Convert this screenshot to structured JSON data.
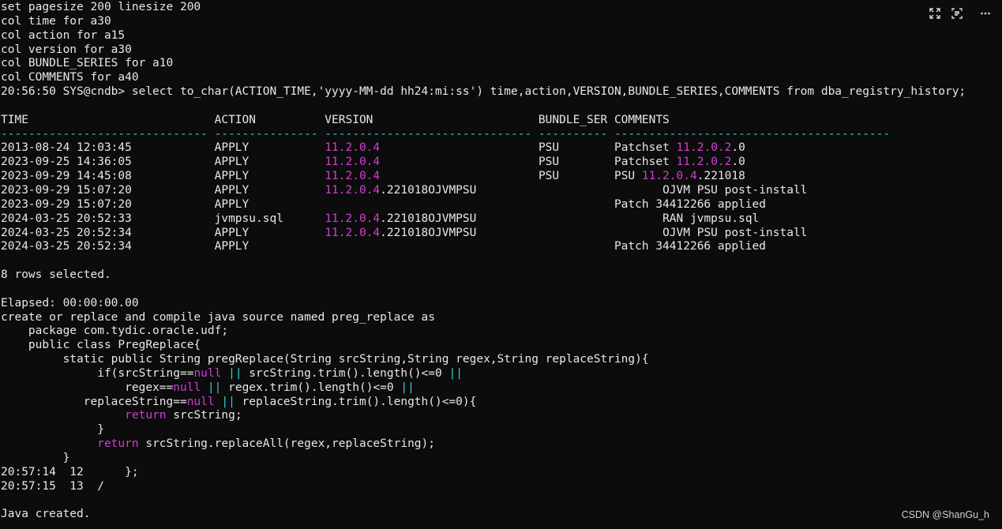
{
  "toolbar": {
    "icons": [
      "expand-icon",
      "ocr-scan-icon",
      "more-options-icon"
    ]
  },
  "colors": {
    "background": "#0c0c0c",
    "text": "#e8e8e8",
    "highlight_magenta": "#d33ed3",
    "separator_cyan": "#3ec8d8"
  },
  "terminal": {
    "lines": [
      [
        {
          "t": "set pagesize 200 linesize 200"
        }
      ],
      [
        {
          "t": "col time for a30"
        }
      ],
      [
        {
          "t": "col action for a15"
        }
      ],
      [
        {
          "t": "col version for a30"
        }
      ],
      [
        {
          "t": "col BUNDLE_SERIES for a10"
        }
      ],
      [
        {
          "t": "col COMMENTS for a40"
        }
      ],
      [
        {
          "t": "20:56:50 SYS@cndb> select to_char(ACTION_TIME,'yyyy-MM-dd hh24:mi:ss') time,action,VERSION,BUNDLE_SERIES,COMMENTS from dba_registry_history;"
        }
      ],
      [],
      [
        {
          "t": "TIME                           ACTION          VERSION                        BUNDLE_SER COMMENTS"
        }
      ],
      [
        {
          "t": "------------------------------ --------------- ------------------------------ ---------- ----------------------------------------",
          "c": "rule"
        }
      ],
      [
        {
          "t": "2013-08-24 12:03:45            APPLY           "
        },
        {
          "t": "11.2.0.4",
          "c": "pk"
        },
        {
          "t": "                       PSU        Patchset "
        },
        {
          "t": "11.2.0.2",
          "c": "pk"
        },
        {
          "t": ".0"
        }
      ],
      [
        {
          "t": "2023-09-25 14:36:05            APPLY           "
        },
        {
          "t": "11.2.0.4",
          "c": "pk"
        },
        {
          "t": "                       PSU        Patchset "
        },
        {
          "t": "11.2.0.2",
          "c": "pk"
        },
        {
          "t": ".0"
        }
      ],
      [
        {
          "t": "2023-09-29 14:45:08            APPLY           "
        },
        {
          "t": "11.2.0.4",
          "c": "pk"
        },
        {
          "t": "                       PSU        PSU "
        },
        {
          "t": "11.2.0.4",
          "c": "pk"
        },
        {
          "t": ".221018"
        }
      ],
      [
        {
          "t": "2023-09-29 15:07:20            APPLY           "
        },
        {
          "t": "11.2.0.4",
          "c": "pk"
        },
        {
          "t": ".221018OJVMPSU                           OJVM PSU post-install"
        }
      ],
      [
        {
          "t": "2023-09-29 15:07:20            APPLY                                                     Patch 34412266 applied"
        }
      ],
      [
        {
          "t": "2024-03-25 20:52:33            jvmpsu.sql      "
        },
        {
          "t": "11.2.0.4",
          "c": "pk"
        },
        {
          "t": ".221018OJVMPSU                           RAN jvmpsu.sql"
        }
      ],
      [
        {
          "t": "2024-03-25 20:52:34            APPLY           "
        },
        {
          "t": "11.2.0.4",
          "c": "pk"
        },
        {
          "t": ".221018OJVMPSU                           OJVM PSU post-install"
        }
      ],
      [
        {
          "t": "2024-03-25 20:52:34            APPLY                                                     Patch 34412266 applied"
        }
      ],
      [],
      [
        {
          "t": "8 rows selected."
        }
      ],
      [],
      [
        {
          "t": "Elapsed: 00:00:00.00"
        }
      ],
      [
        {
          "t": "create or replace and compile java source named preg_replace as"
        }
      ],
      [
        {
          "t": "    package com.tydic.oracle.udf;"
        }
      ],
      [
        {
          "t": "    public class PregReplace{"
        }
      ],
      [
        {
          "t": "         static public String pregReplace(String srcString,String regex,String replaceString){"
        }
      ],
      [
        {
          "t": "              if(srcString=="
        },
        {
          "t": "null",
          "c": "pk"
        },
        {
          "t": " "
        },
        {
          "t": "||",
          "c": "rule"
        },
        {
          "t": " srcString.trim().length()<=0 "
        },
        {
          "t": "||",
          "c": "rule"
        }
      ],
      [
        {
          "t": "                  regex=="
        },
        {
          "t": "null",
          "c": "pk"
        },
        {
          "t": " "
        },
        {
          "t": "||",
          "c": "rule"
        },
        {
          "t": " regex.trim().length()<=0 "
        },
        {
          "t": "||",
          "c": "rule"
        }
      ],
      [
        {
          "t": "            replaceString=="
        },
        {
          "t": "null",
          "c": "pk"
        },
        {
          "t": " "
        },
        {
          "t": "||",
          "c": "rule"
        },
        {
          "t": " replaceString.trim().length()<=0){"
        }
      ],
      [
        {
          "t": "                  "
        },
        {
          "t": "return",
          "c": "pk"
        },
        {
          "t": " srcString;"
        }
      ],
      [
        {
          "t": "              }"
        }
      ],
      [
        {
          "t": "              "
        },
        {
          "t": "return",
          "c": "pk"
        },
        {
          "t": " srcString.replaceAll(regex,replaceString);"
        }
      ],
      [
        {
          "t": "         }"
        }
      ],
      [
        {
          "t": "20:57:14  12      };"
        }
      ],
      [
        {
          "t": "20:57:15  13  /"
        }
      ],
      [],
      [
        {
          "t": "Java created."
        }
      ]
    ]
  },
  "watermark": "CSDN @ShanGu_h"
}
